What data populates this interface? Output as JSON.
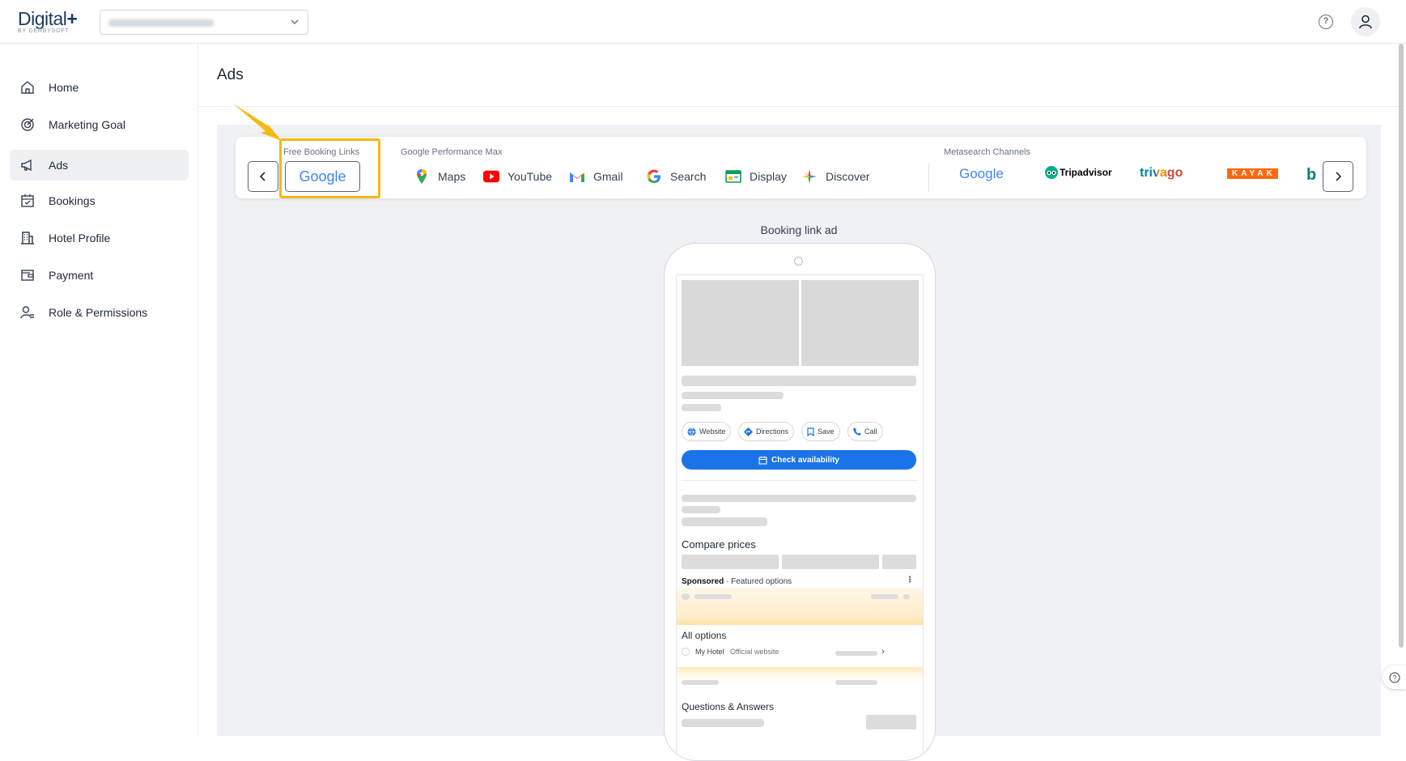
{
  "brand": {
    "name": "Digital",
    "plus": "+",
    "sub": "BY DERBYSOFT"
  },
  "header": {
    "hotel_select_value": "",
    "help_icon": "question-circle-icon",
    "avatar_icon": "user-icon"
  },
  "sidebar": {
    "items": [
      {
        "label": "Home",
        "icon": "home-icon"
      },
      {
        "label": "Marketing Goal",
        "icon": "target-icon"
      },
      {
        "label": "Ads",
        "icon": "megaphone-icon"
      },
      {
        "label": "Bookings",
        "icon": "calendar-icon"
      },
      {
        "label": "Hotel Profile",
        "icon": "building-icon"
      },
      {
        "label": "Payment",
        "icon": "wallet-icon"
      },
      {
        "label": "Role & Permissions",
        "icon": "user-roles-icon"
      }
    ],
    "active_index": 2
  },
  "page": {
    "title": "Ads"
  },
  "channels": {
    "free_booking_label": "Free Booking Links",
    "free_booking_google": "Google",
    "pmax_label": "Google Performance Max",
    "pmax_items": [
      {
        "label": "Maps",
        "icon": "maps-pin-icon"
      },
      {
        "label": "YouTube",
        "icon": "youtube-icon"
      },
      {
        "label": "Gmail",
        "icon": "gmail-icon"
      },
      {
        "label": "Search",
        "icon": "google-g-icon"
      },
      {
        "label": "Display",
        "icon": "display-icon"
      },
      {
        "label": "Discover",
        "icon": "discover-icon"
      }
    ],
    "meta_label": "Metasearch Channels",
    "meta_items": [
      "Google",
      "Tripadvisor",
      "trivago",
      "KAYAK",
      "b"
    ]
  },
  "preview": {
    "caption": "Booking link ad",
    "chips": [
      "Website",
      "Directions",
      "Save",
      "Call"
    ],
    "check_button": "Check availability",
    "compare_prices": "Compare prices",
    "sponsored": "Sponsored",
    "featured": " · Featured options",
    "all_options": "All options",
    "my_hotel": "My Hotel",
    "official_website": "Official website",
    "questions": "Questions & Answers"
  },
  "colors": {
    "accent": "#1a73e8",
    "highlight": "#f5b814",
    "active_nav": "#eef0f3"
  }
}
